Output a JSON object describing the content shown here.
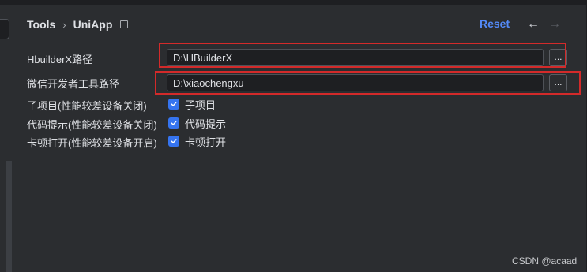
{
  "breadcrumb": {
    "parent": "Tools",
    "separator": "›",
    "current": "UniApp"
  },
  "header": {
    "reset_label": "Reset",
    "back_arrow": "←",
    "forward_arrow": "→"
  },
  "fields": [
    {
      "label": "HbuilderX路径",
      "value": "D:\\HBuilderX",
      "browse_label": "..."
    },
    {
      "label": "微信开发者工具路径",
      "value": "D:\\xiaochengxu",
      "browse_label": "..."
    }
  ],
  "options": [
    {
      "label": "子项目(性能较差设备关闭)",
      "check_label": "子项目",
      "checked": true
    },
    {
      "label": "代码提示(性能较差设备关闭)",
      "check_label": "代码提示",
      "checked": true
    },
    {
      "label": "卡顿打开(性能较差设备开启)",
      "check_label": "卡顿打开",
      "checked": true
    }
  ],
  "watermark": "CSDN @acaad",
  "colors": {
    "background": "#2b2d30",
    "accent": "#548af7",
    "checkbox": "#3574f0",
    "highlight": "#d32a2a"
  }
}
